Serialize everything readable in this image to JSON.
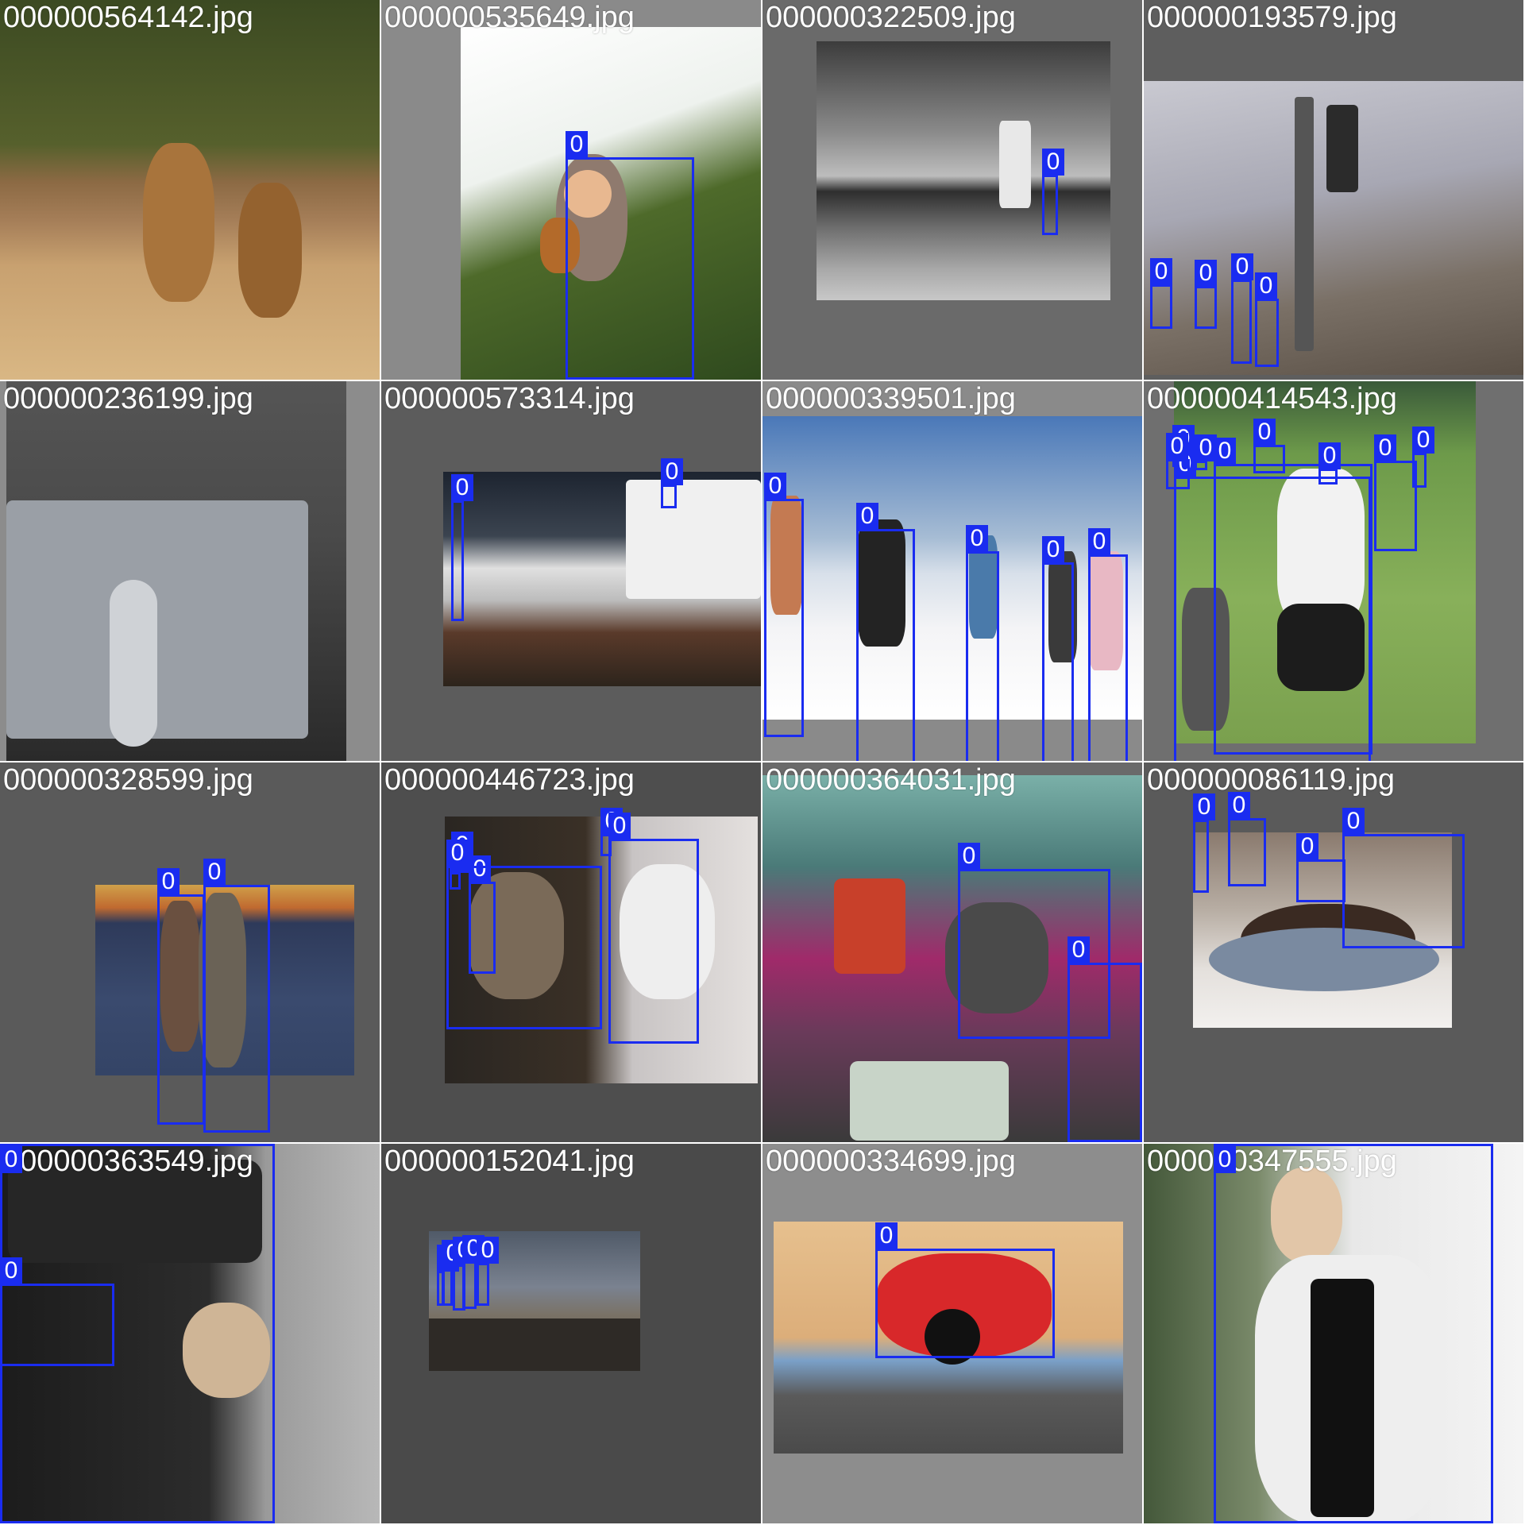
{
  "grid": {
    "tiles": [
      {
        "filename": "000000564142.jpg",
        "scene": "giraffe",
        "bg": "#6c6c6c",
        "boxes": []
      },
      {
        "filename": "000000535649.jpg",
        "scene": "child",
        "bg": "#8a8a8a",
        "boxes": [
          {
            "label": "0"
          }
        ]
      },
      {
        "filename": "000000322509.jpg",
        "scene": "windsurf",
        "bg": "#6a6a6a",
        "boxes": [
          {
            "label": "0"
          }
        ]
      },
      {
        "filename": "000000193579.jpg",
        "scene": "street",
        "bg": "#5e5e5e",
        "boxes": [
          {
            "label": "0"
          },
          {
            "label": "0"
          },
          {
            "label": "0"
          },
          {
            "label": "0"
          }
        ]
      },
      {
        "filename": "000000236199.jpg",
        "scene": "case",
        "bg": "#8c8c8c",
        "boxes": []
      },
      {
        "filename": "000000573314.jpg",
        "scene": "boat",
        "bg": "#5c5c5c",
        "boxes": [
          {
            "label": "0"
          },
          {
            "label": "0"
          }
        ]
      },
      {
        "filename": "000000339501.jpg",
        "scene": "ski",
        "bg": "#8a8a8a",
        "boxes": [
          {
            "label": "0"
          },
          {
            "label": "0"
          },
          {
            "label": "0"
          },
          {
            "label": "0"
          },
          {
            "label": "0"
          }
        ]
      },
      {
        "filename": "000000414543.jpg",
        "scene": "frisbee",
        "bg": "#6f6f6f",
        "boxes": [
          {
            "label": "0"
          },
          {
            "label": "0"
          },
          {
            "label": "0"
          },
          {
            "label": "0"
          },
          {
            "label": "0"
          },
          {
            "label": "0"
          },
          {
            "label": "0"
          },
          {
            "label": "0"
          },
          {
            "label": "0"
          }
        ]
      },
      {
        "filename": "000000328599.jpg",
        "scene": "couple",
        "bg": "#5a5a5a",
        "boxes": [
          {
            "label": "0"
          },
          {
            "label": "0"
          }
        ]
      },
      {
        "filename": "000000446723.jpg",
        "scene": "photo",
        "bg": "#4e4e4e",
        "boxes": [
          {
            "label": "0"
          },
          {
            "label": "0"
          },
          {
            "label": "0"
          },
          {
            "label": "0"
          },
          {
            "label": "0"
          },
          {
            "label": "0"
          }
        ]
      },
      {
        "filename": "000000364031.jpg",
        "scene": "market",
        "bg": "#6a6a6a",
        "boxes": [
          {
            "label": "0"
          },
          {
            "label": "0"
          }
        ]
      },
      {
        "filename": "000000086119.jpg",
        "scene": "cake",
        "bg": "#5a5a5a",
        "boxes": [
          {
            "label": "0"
          },
          {
            "label": "0"
          },
          {
            "label": "0"
          },
          {
            "label": "0"
          }
        ]
      },
      {
        "filename": "000000363549.jpg",
        "scene": "dog",
        "bg": "#777777",
        "boxes": [
          {
            "label": "0"
          },
          {
            "label": "0"
          }
        ]
      },
      {
        "filename": "000000152041.jpg",
        "scene": "station",
        "bg": "#4a4a4a",
        "boxes": [
          {
            "label": "0"
          },
          {
            "label": "0"
          },
          {
            "label": "0"
          },
          {
            "label": "0"
          },
          {
            "label": "0"
          }
        ]
      },
      {
        "filename": "000000334699.jpg",
        "scene": "moto",
        "bg": "#8d8d8d",
        "boxes": [
          {
            "label": "0"
          }
        ]
      },
      {
        "filename": "000000347555.jpg",
        "scene": "woman",
        "bg": "#8a8a8a",
        "boxes": [
          {
            "label": "0"
          }
        ]
      }
    ]
  },
  "colors": {
    "box": "#1a2cf0",
    "label_text": "#ffffff"
  }
}
